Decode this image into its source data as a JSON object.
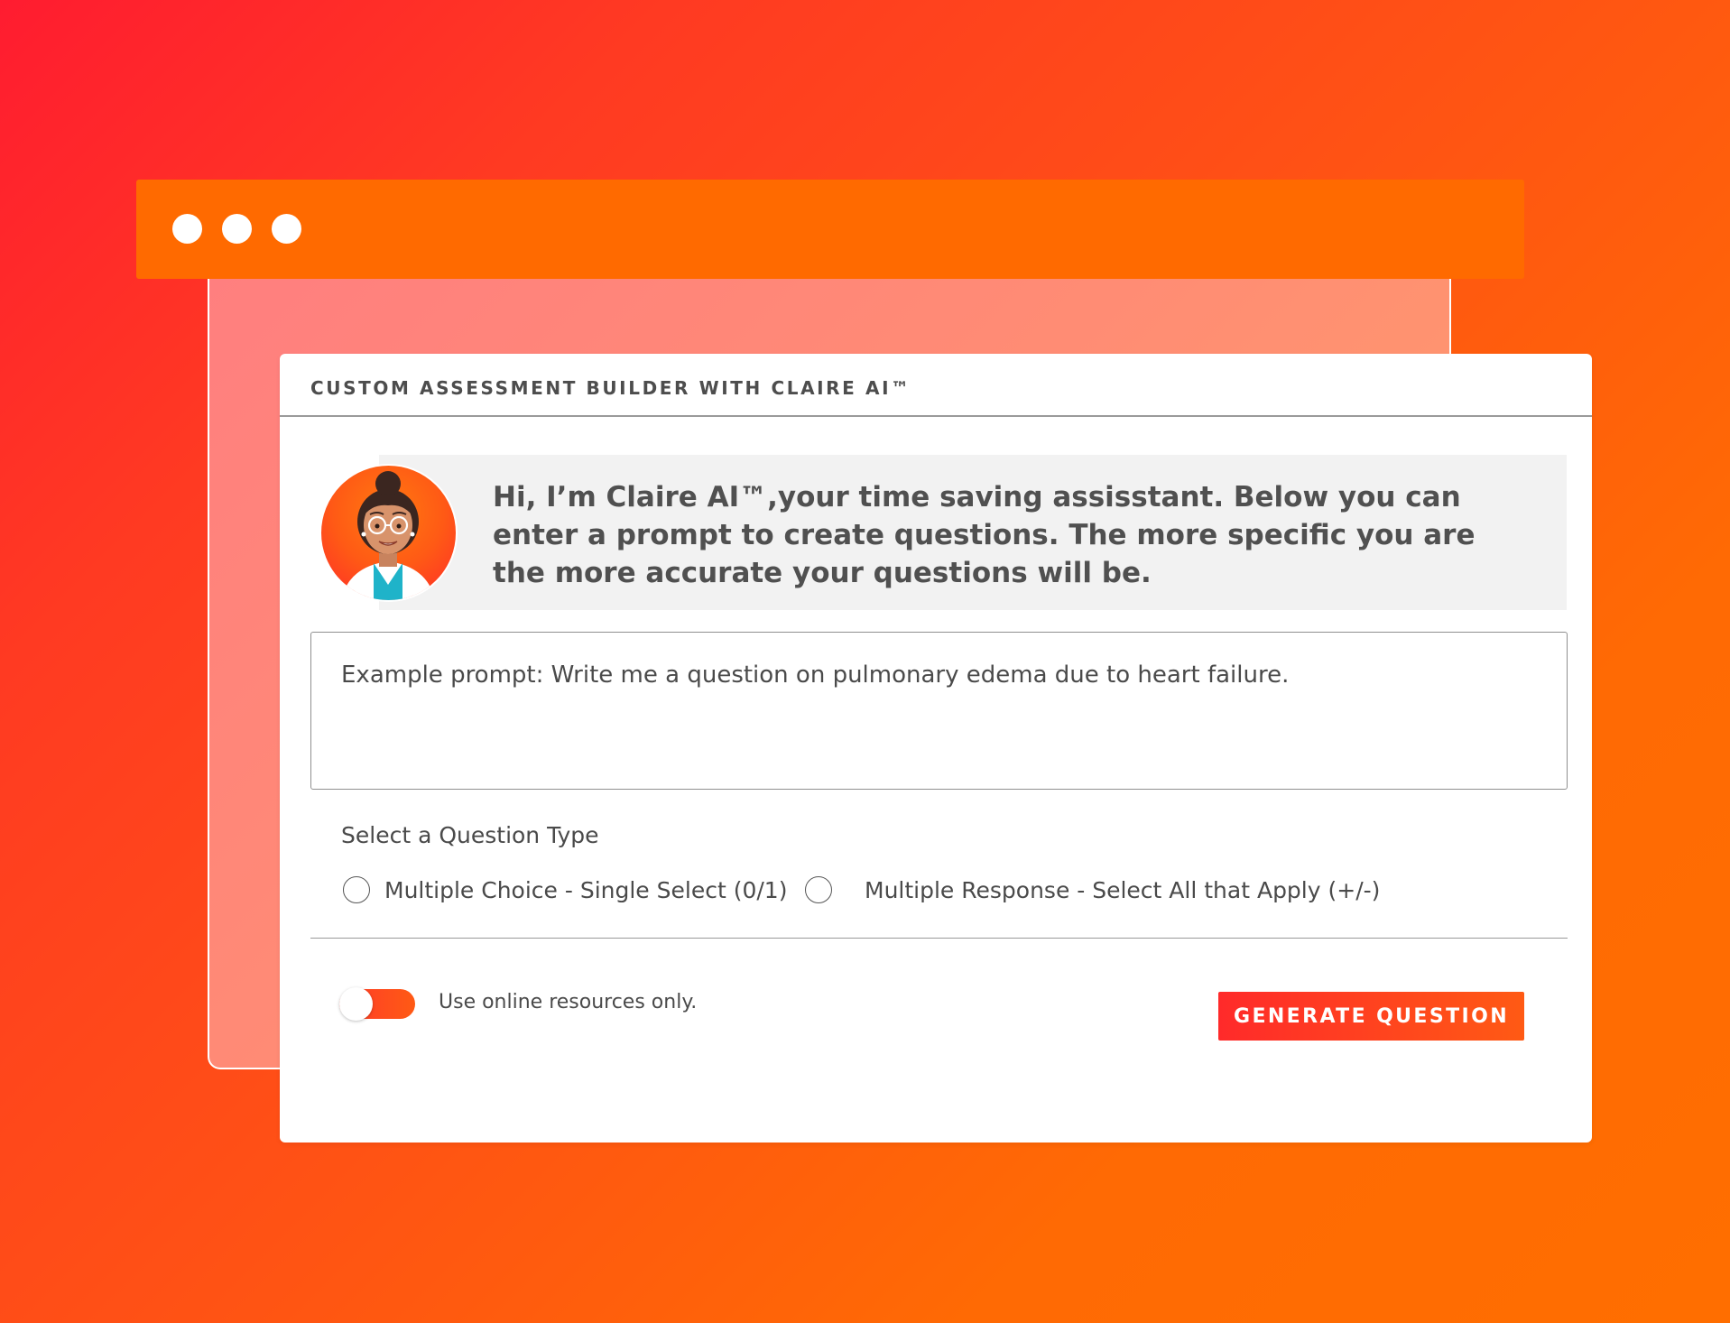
{
  "window": {
    "controls": [
      "dot-icon",
      "dot-icon",
      "dot-icon"
    ]
  },
  "card": {
    "title": "CUSTOM ASSESSMENT BUILDER WITH CLAIRE AI™"
  },
  "assistant": {
    "avatar_icon": "claire-avatar-icon",
    "greeting": "Hi, I’m Claire AI™,your time saving assisstant. Below you can enter a prompt to create questions. The more specific you are the more accurate your questions will be."
  },
  "prompt": {
    "placeholder": "Example prompt: Write me a question on pulmonary edema due to heart failure.",
    "value": ""
  },
  "question_type": {
    "label": "Select a Question Type",
    "options": [
      {
        "label": "Multiple Choice - Single Select (0/1)",
        "selected": false
      },
      {
        "label": "Multiple Response - Select All that Apply (+/-)",
        "selected": false
      }
    ]
  },
  "online_resources": {
    "label": "Use online resources only.",
    "enabled": true
  },
  "actions": {
    "generate_label": "GENERATE QUESTION"
  },
  "colors": {
    "accent": "#ff6a00",
    "button_start": "#ff2a2a",
    "button_end": "#ff5a14",
    "text": "#4a4a4a",
    "greeting_bg": "#f2f2f2"
  }
}
